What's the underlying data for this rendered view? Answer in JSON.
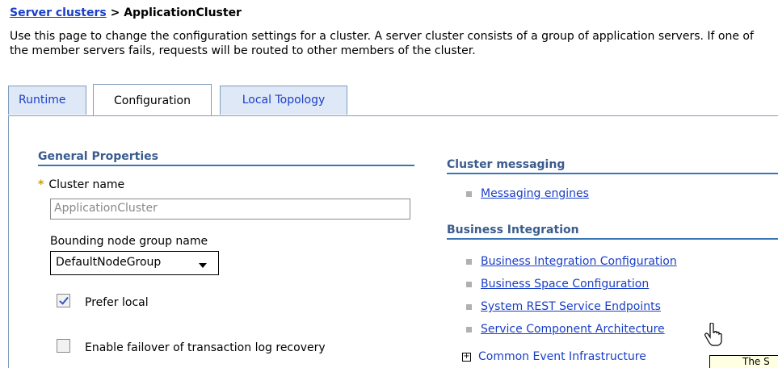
{
  "breadcrumb": {
    "parent": "Server clusters",
    "separator": " > ",
    "current": "ApplicationCluster"
  },
  "description": "Use this page to change the configuration settings for a cluster. A server cluster consists of a group of application servers. If one of the member servers fails, requests will be routed to other members of the cluster.",
  "tabs": [
    {
      "label": "Runtime",
      "active": false
    },
    {
      "label": "Configuration",
      "active": true
    },
    {
      "label": "Local Topology",
      "active": false
    }
  ],
  "general_properties": {
    "heading": "General Properties",
    "required_marker": "*",
    "cluster_name_label": "Cluster name",
    "cluster_name_value": "ApplicationCluster",
    "bounding_label": "Bounding node group name",
    "bounding_value": "DefaultNodeGroup",
    "prefer_local_label": "Prefer local",
    "prefer_local_checked": true,
    "failover_label": "Enable failover of transaction log recovery",
    "failover_checked": false
  },
  "cluster_messaging": {
    "heading": "Cluster messaging",
    "links": [
      "Messaging engines"
    ]
  },
  "business_integration": {
    "heading": "Business Integration",
    "links": [
      "Business Integration Configuration",
      "Business Space Configuration",
      "System REST Service Endpoints",
      "Service Component Architecture"
    ],
    "expander_symbol": "+",
    "expandable": "Common Event Infrastructure"
  },
  "tooltip": {
    "text": "The S"
  },
  "colors": {
    "link": "#1a3fc8",
    "section_heading": "#3a5c8e",
    "tab_inactive_bg": "#dfe8f6",
    "required_marker": "#c8a000"
  }
}
